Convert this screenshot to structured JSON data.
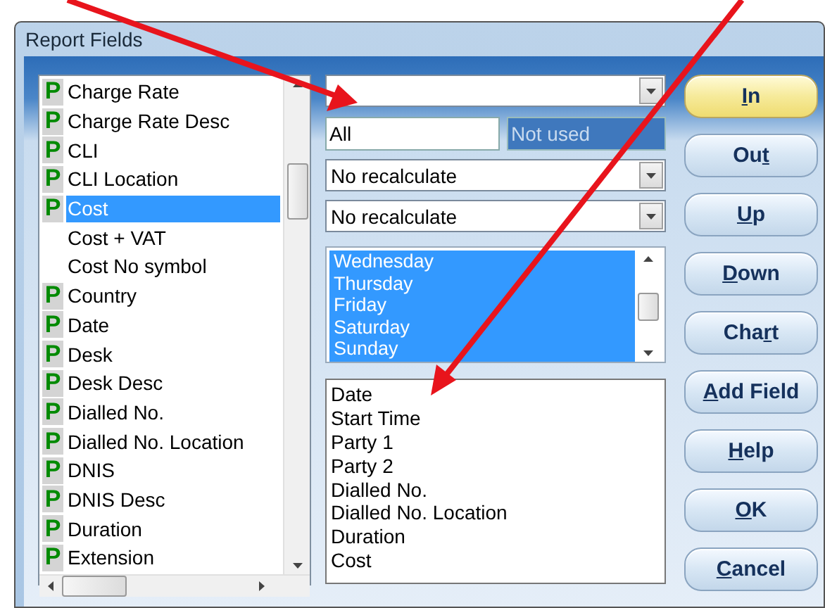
{
  "window": {
    "title": "Report Fields"
  },
  "field_list": {
    "items": [
      {
        "badge": "P",
        "label": "Charge Rate",
        "selected": false
      },
      {
        "badge": "P",
        "label": "Charge Rate Desc",
        "selected": false
      },
      {
        "badge": "P",
        "label": "CLI",
        "selected": false
      },
      {
        "badge": "P",
        "label": "CLI Location",
        "selected": false
      },
      {
        "badge": "P",
        "label": "Cost",
        "selected": true
      },
      {
        "label": "Cost + VAT",
        "selected": false
      },
      {
        "label": "Cost No symbol",
        "selected": false
      },
      {
        "badge": "P",
        "label": "Country",
        "selected": false
      },
      {
        "badge": "P",
        "label": "Date",
        "selected": false
      },
      {
        "badge": "P",
        "label": "Desk",
        "selected": false
      },
      {
        "badge": "P",
        "label": "Desk Desc",
        "selected": false
      },
      {
        "badge": "P",
        "label": "Dialled No.",
        "selected": false
      },
      {
        "badge": "P",
        "label": "Dialled No. Location",
        "selected": false
      },
      {
        "badge": "P",
        "label": "DNIS",
        "selected": false
      },
      {
        "badge": "P",
        "label": "DNIS Desc",
        "selected": false
      },
      {
        "badge": "P",
        "label": "Duration",
        "selected": false
      },
      {
        "badge": "P",
        "label": "Extension",
        "selected": false
      }
    ]
  },
  "filter_field": {
    "value": "All"
  },
  "unused_field": {
    "value": "Not used",
    "disabled": true
  },
  "recalc_combos": [
    {
      "value": "No recalculate"
    },
    {
      "value": "No recalculate"
    }
  ],
  "days_list": {
    "items": [
      {
        "label": "Wednesday",
        "selected": true
      },
      {
        "label": "Thursday",
        "selected": true
      },
      {
        "label": "Friday",
        "selected": true
      },
      {
        "label": "Saturday",
        "selected": true
      },
      {
        "label": "Sunday",
        "selected": true
      }
    ]
  },
  "report_list": {
    "items": [
      "Date",
      "Start Time",
      "Party 1",
      "Party 2",
      "Dialled No.",
      "Dialled No. Location",
      "Duration",
      "Cost"
    ]
  },
  "buttons": [
    {
      "key": "I",
      "post": "n",
      "default": true
    },
    {
      "pre": "Ou",
      "key": "t",
      "default": false
    },
    {
      "key": "U",
      "post": "p",
      "default": false
    },
    {
      "key": "D",
      "post": "own",
      "default": false
    },
    {
      "pre": "Cha",
      "key": "r",
      "post": "t",
      "default": false
    },
    {
      "key": "A",
      "post": "dd Field",
      "default": false
    },
    {
      "key": "H",
      "post": "elp",
      "default": false
    },
    {
      "key": "O",
      "post": "K",
      "default": false
    },
    {
      "key": "C",
      "post": "ancel",
      "default": false
    }
  ]
}
